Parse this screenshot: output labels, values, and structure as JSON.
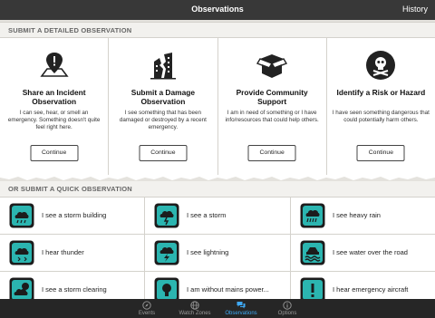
{
  "navbar": {
    "title": "Observations",
    "history_label": "History"
  },
  "detailed": {
    "heading": "SUBMIT A DETAILED OBSERVATION",
    "cards": [
      {
        "title": "Share an Incident Observation",
        "description": "I can see, hear, or smell an emergency. Something doesn't quite feel right here.",
        "button": "Continue",
        "icon": "map-pin-exclamation-icon"
      },
      {
        "title": "Submit a Damage Observation",
        "description": "I see something that has been damaged or destroyed by a recent emergency.",
        "button": "Continue",
        "icon": "damaged-building-icon"
      },
      {
        "title": "Provide Community Support",
        "description": "I am in need of something or I have info/resources that could help others.",
        "button": "Continue",
        "icon": "open-box-icon"
      },
      {
        "title": "Identify a Risk or Hazard",
        "description": "I have seen something dangerous that could potentially harm others.",
        "button": "Continue",
        "icon": "skull-crossbones-icon"
      }
    ]
  },
  "quick": {
    "heading": "OR SUBMIT A QUICK OBSERVATION",
    "items": [
      {
        "label": "I see a storm building",
        "icon": "storm-cloud-icon"
      },
      {
        "label": "I see a storm",
        "icon": "storm-cloud-icon"
      },
      {
        "label": "I see heavy rain",
        "icon": "rain-cloud-icon"
      },
      {
        "label": "I hear thunder",
        "icon": "thunder-cloud-icon"
      },
      {
        "label": "I see lightning",
        "icon": "lightning-cloud-icon"
      },
      {
        "label": "I see water over the road",
        "icon": "flood-road-icon"
      },
      {
        "label": "I see a storm clearing",
        "icon": "storm-clearing-icon"
      },
      {
        "label": "I am without mains power...",
        "icon": "lightbulb-icon"
      },
      {
        "label": "I hear emergency aircraft",
        "icon": "exclamation-icon"
      }
    ]
  },
  "tabs": [
    {
      "label": "Events",
      "icon": "compass-icon",
      "active": false
    },
    {
      "label": "Watch Zones",
      "icon": "globe-icon",
      "active": false
    },
    {
      "label": "Observations",
      "icon": "chat-bubbles-icon",
      "active": true
    },
    {
      "label": "Options",
      "icon": "info-icon",
      "active": false
    }
  ],
  "colors": {
    "navbar": "#383838",
    "tabbar": "#262626",
    "accent": "#3fa9f5",
    "quick_icon_fill": "#2bb5b0",
    "quick_icon_dark": "#1c1c1c"
  }
}
